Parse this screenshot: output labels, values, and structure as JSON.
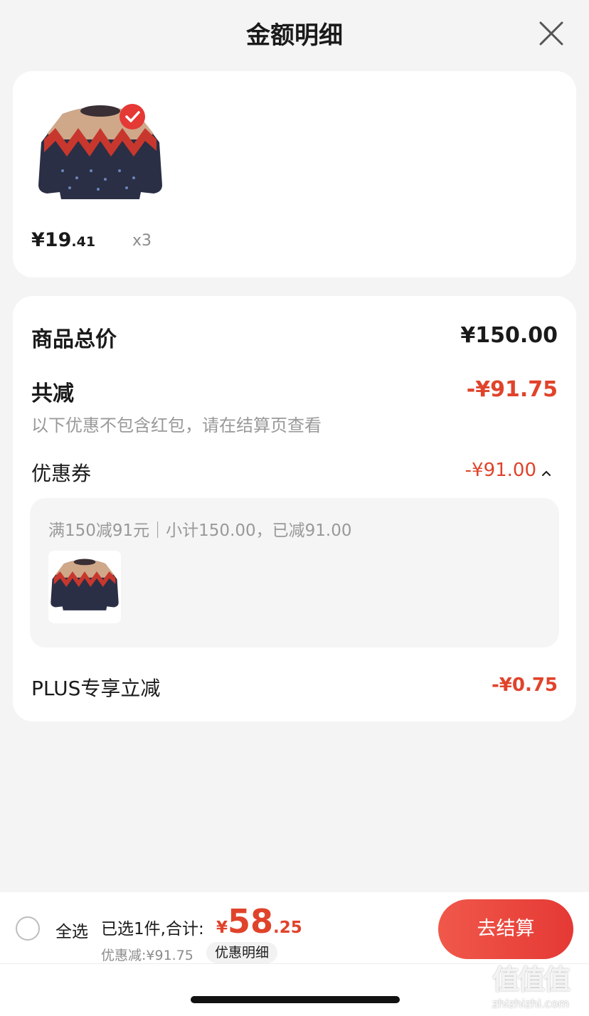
{
  "header": {
    "title": "金额明细"
  },
  "items_card": {
    "items": [
      {
        "price_main": "¥19",
        "price_decimal": ".41",
        "quantity": "x3",
        "selected": true
      }
    ]
  },
  "summary": {
    "total_label": "商品总价",
    "total_value": "¥150.00",
    "reduction_label": "共减",
    "reduction_value": "-¥91.75",
    "note": "以下优惠不包含红包，请在结算页查看",
    "coupon_label": "优惠券",
    "coupon_value": "-¥91.00",
    "coupon_desc": "满150减91元｜小计150.00，已减91.00",
    "plus_label": "PLUS专享立减",
    "plus_value": "-¥0.75"
  },
  "bottom_bar": {
    "select_all_label": "全选",
    "selected_info": "已选1件,合计:",
    "total_currency": "¥",
    "total_main": "58",
    "total_decimal": ".25",
    "discount_info": "优惠减:¥91.75",
    "detail_link": "优惠明细",
    "checkout_label": "去结算"
  },
  "watermark": {
    "glyphs": "值值值",
    "url": "zhizhizhi.com"
  },
  "colors": {
    "accent_red": "#e0432b",
    "checkout_gradient": [
      "#f0584a",
      "#e53935"
    ],
    "background": "#f4f4f4"
  }
}
